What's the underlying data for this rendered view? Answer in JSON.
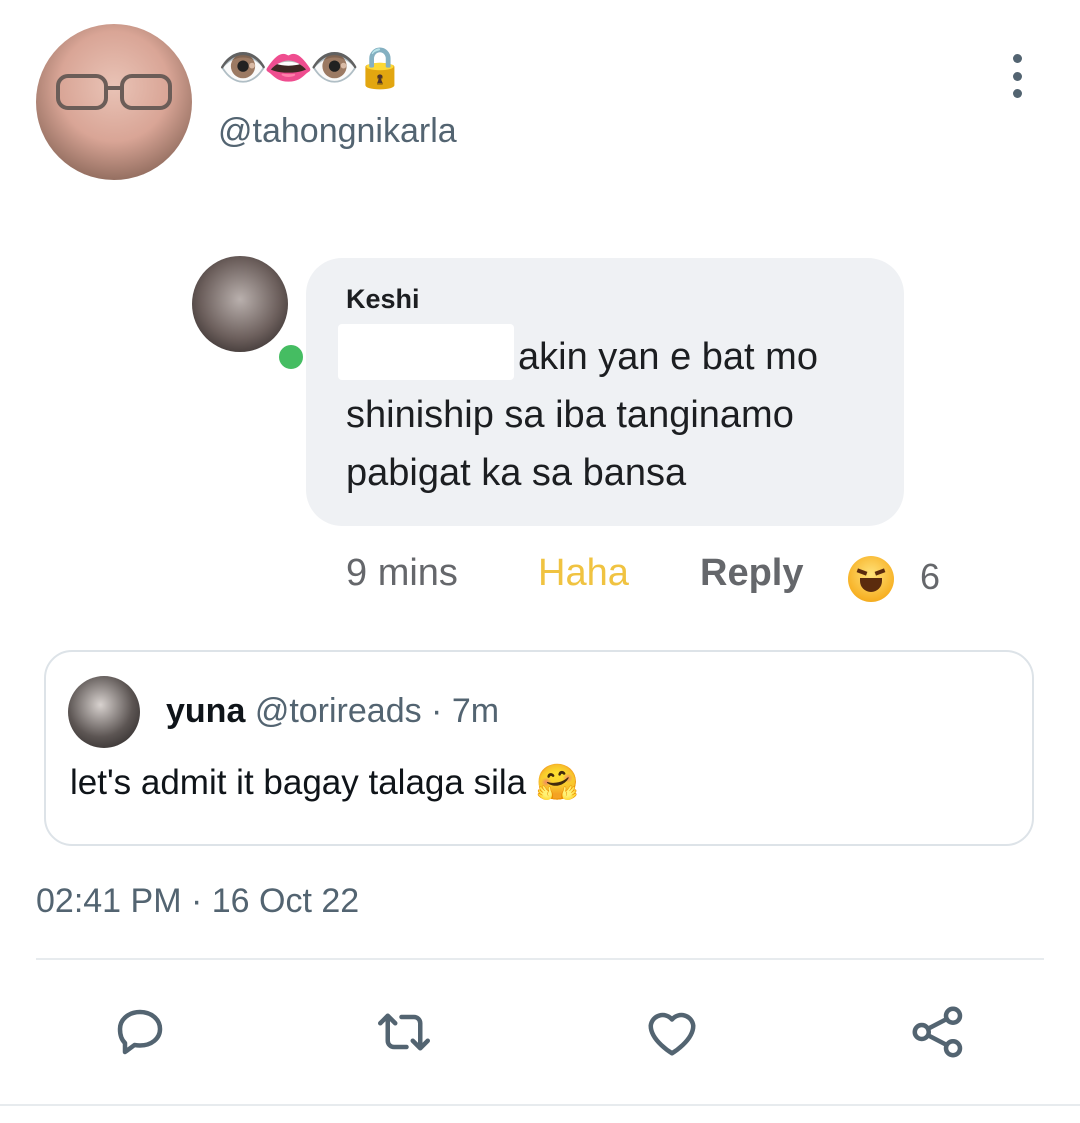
{
  "tweet": {
    "display_name": "👁️👄👁️🔒",
    "handle": "@tahongnikarla",
    "timestamp": "02:41 PM · 16 Oct 22"
  },
  "comment": {
    "name": "Keshi",
    "text": "akin yan e bat mo shiniship sa iba tanginamo pabigat ka sa bansa",
    "time": "9 mins",
    "haha_label": "Haha",
    "reply_label": "Reply",
    "reaction_count": "6"
  },
  "quote": {
    "name": "yuna",
    "handle_time": "@torireads · 7m",
    "text": "let's admit it bagay talaga sila 🤗"
  },
  "icons": {
    "reply": "reply-icon",
    "retweet": "retweet-icon",
    "like": "like-icon",
    "share": "share-icon",
    "more": "more-options-icon"
  },
  "colors": {
    "secondary_text": "#536471",
    "haha_active": "#f0c341",
    "online": "#45bd62"
  }
}
